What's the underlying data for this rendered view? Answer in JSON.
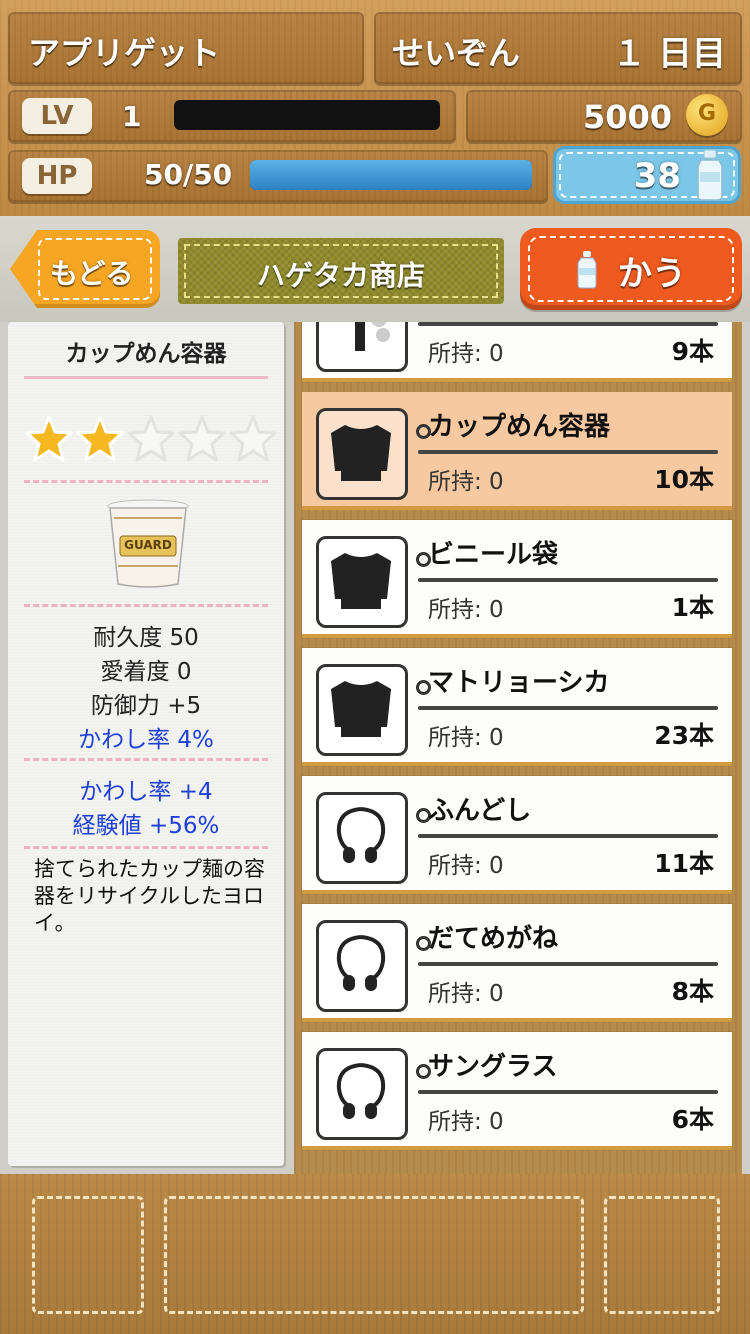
{
  "header": {
    "app_name": "アプリゲット",
    "mode": "せいぞん",
    "day": "１ 日目",
    "level_badge": "LV",
    "level": "1",
    "gold": "5000",
    "hp_badge": "HP",
    "hp": "50/50",
    "hp_fraction": 1.0,
    "water": "38"
  },
  "nav": {
    "back_label": "もどる",
    "shop_title": "ハゲタカ商店",
    "buy_label": "かう"
  },
  "detail": {
    "name": "カップめん容器",
    "stars_filled": 2,
    "stars_total": 5,
    "logo_text": "GUARD",
    "stats": [
      "耐久度 50",
      "愛着度 0",
      "防御力 +5"
    ],
    "evade_rate": "かわし率 4%",
    "bonus": [
      "かわし率 +4",
      "経験値 +56%"
    ],
    "description": "捨てられたカップ麺の容器をリサイクルしたヨロイ。"
  },
  "items": [
    {
      "name": "",
      "owned": "所持: 0",
      "count": "9本",
      "icon": "broom-icon",
      "selected": false
    },
    {
      "name": "カップめん容器",
      "owned": "所持: 0",
      "count": "10本",
      "icon": "shirt-icon",
      "selected": true
    },
    {
      "name": "ビニール袋",
      "owned": "所持: 0",
      "count": "1本",
      "icon": "shirt-icon",
      "selected": false
    },
    {
      "name": "マトリョーシカ",
      "owned": "所持: 0",
      "count": "23本",
      "icon": "shirt-icon",
      "selected": false
    },
    {
      "name": "ふんどし",
      "owned": "所持: 0",
      "count": "11本",
      "icon": "necklace-icon",
      "selected": false
    },
    {
      "name": "だてめがね",
      "owned": "所持: 0",
      "count": "8本",
      "icon": "necklace-icon",
      "selected": false
    },
    {
      "name": "サングラス",
      "owned": "所持: 0",
      "count": "6本",
      "icon": "necklace-icon",
      "selected": false
    }
  ],
  "colors": {
    "accent_orange": "#ef5a1e",
    "back_yellow": "#f6a623",
    "hp_blue": "#3d96d4",
    "evade_blue": "#1e3fd8",
    "selected_row": "#f7c9a0"
  }
}
